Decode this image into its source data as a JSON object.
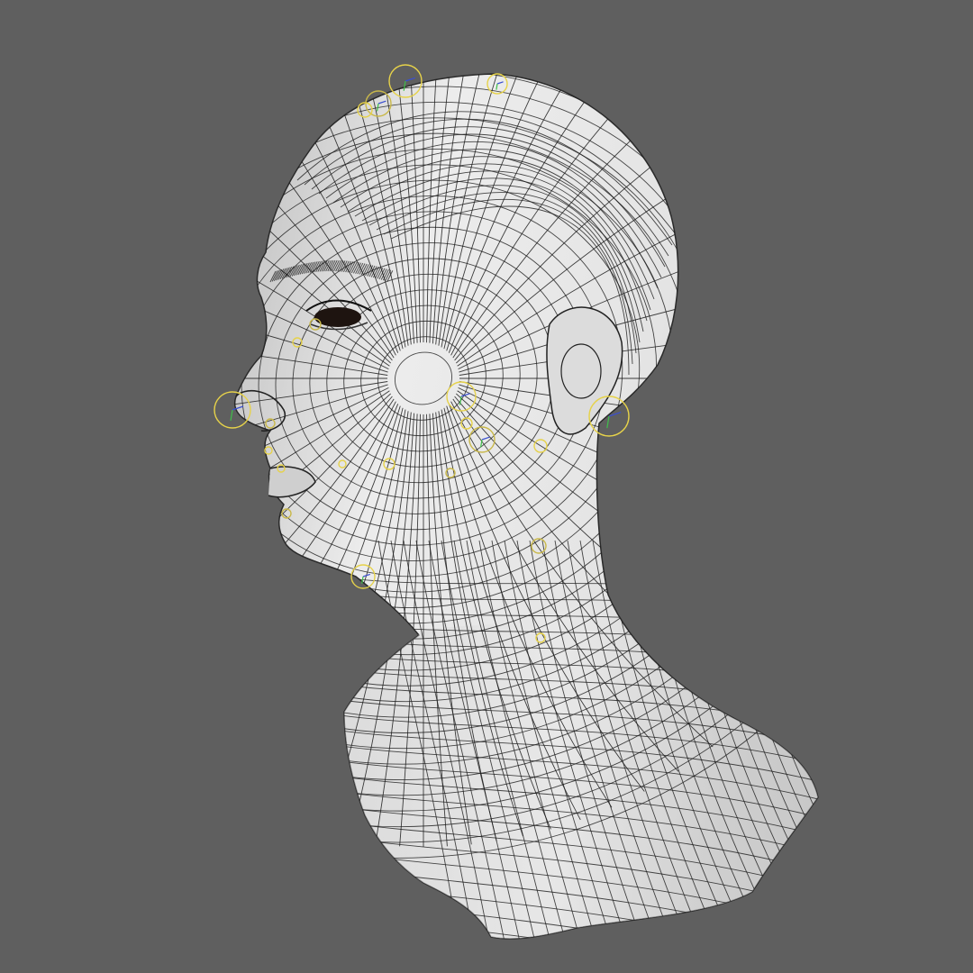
{
  "viewport": {
    "background": "#5f5f5f",
    "shading": "smooth-shaded-wireframe",
    "model": "head-bust-mesh"
  },
  "colors": {
    "mesh_fill": "#e6e6e6",
    "mesh_shadow": "#b4b4b4",
    "wire": "#1c1c1c",
    "rig_control": "#e6d24a",
    "rig_secondary": "#c9b84a",
    "manipulator_blue": "#3a4fd0",
    "manipulator_green": "#3fbf4a",
    "eye": "#1e1410"
  },
  "rig": {
    "control_count": 22,
    "control_shape": "circle"
  }
}
